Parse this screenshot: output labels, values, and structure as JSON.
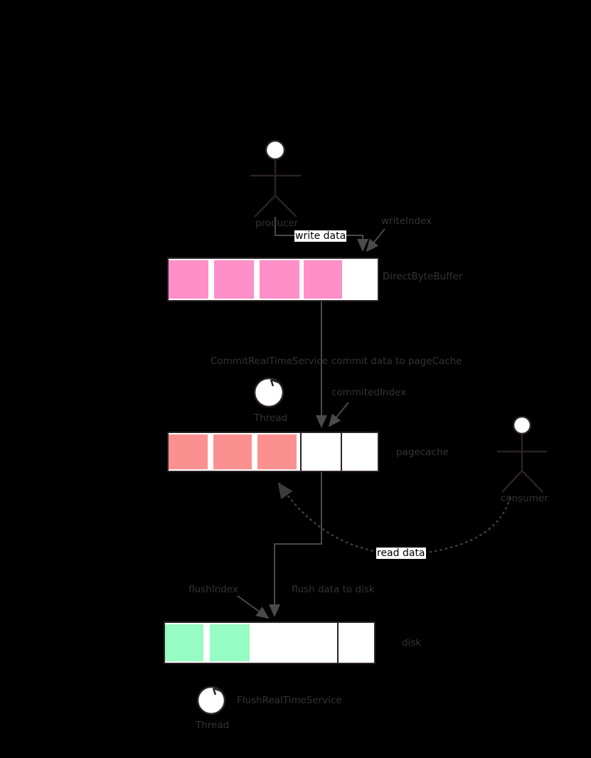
{
  "diagram": {
    "title_hidden": "",
    "actors": {
      "producer": {
        "label": "producer"
      },
      "consumer": {
        "label": "consumer"
      },
      "commit_thread": {
        "service": "CommitRealTimeService",
        "label": "Thread"
      },
      "flush_thread": {
        "service": "FlushRealTimeService",
        "label": "Thread"
      }
    },
    "edges": {
      "write_data": "write data",
      "commit_data": "commit data to pageCache",
      "flush_data": "flush data to disk",
      "read_data": "read data"
    },
    "indices": {
      "write_index": "writeIndex",
      "commited_index": "commitedIndex",
      "flush_index": "flushIndex"
    },
    "rows": [
      {
        "name": "DirectByteBuffer",
        "label": "DirectByteBuffer",
        "fill": "#ff8fc8",
        "cells": [
          "filled",
          "filled",
          "filled",
          "filled",
          "empty"
        ]
      },
      {
        "name": "pagecache",
        "label": "pagecache",
        "fill": "#fa9190",
        "cells": [
          "filled",
          "filled",
          "filled",
          "empty",
          "empty"
        ]
      },
      {
        "name": "disk",
        "label": "disk",
        "fill": "#96fcc3",
        "cells": [
          "filled",
          "filled",
          "empty",
          "empty",
          "empty"
        ]
      }
    ],
    "colors": {
      "background": "#000000",
      "stroke": "#2b2224",
      "line": "#4a4a4a",
      "text": "#333333",
      "buffer_pink": "#ff8fc8",
      "pagecache_salmon": "#fa9190",
      "disk_green": "#96fcc3",
      "actor_fill": "#ffffff"
    }
  }
}
